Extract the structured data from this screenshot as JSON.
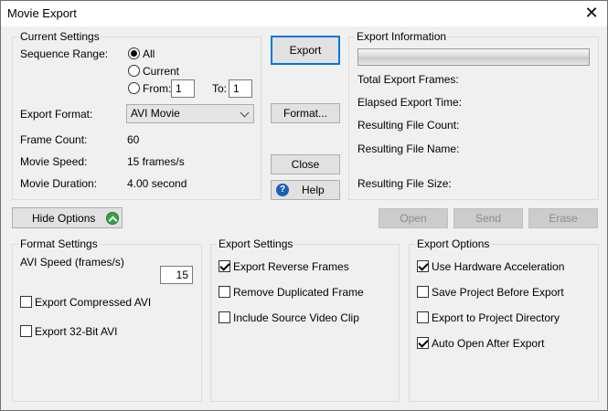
{
  "window": {
    "title": "Movie Export",
    "close_glyph": "✕"
  },
  "current_settings": {
    "title": "Current Settings",
    "sequence_range_label": "Sequence Range:",
    "radio_all": "All",
    "radio_current": "Current",
    "radio_from": "From:",
    "from_value": "1",
    "to_label": "To:",
    "to_value": "1",
    "selected_range": "All",
    "export_format_label": "Export Format:",
    "export_format_value": "AVI Movie",
    "frame_count_label": "Frame Count:",
    "frame_count_value": "60",
    "movie_speed_label": "Movie Speed:",
    "movie_speed_value": "15 frames/s",
    "movie_duration_label": "Movie Duration:",
    "movie_duration_value": "4.00 second"
  },
  "actions": {
    "export": "Export",
    "format": "Format...",
    "close": "Close",
    "help": "Help",
    "help_icon": "?"
  },
  "export_information": {
    "title": "Export Information",
    "progress": 0,
    "total_frames_label": "Total Export Frames:",
    "elapsed_time_label": "Elapsed Export Time:",
    "file_count_label": "Resulting File Count:",
    "file_name_label": "Resulting File Name:",
    "file_size_label": "Resulting File Size:"
  },
  "toolbar": {
    "hide_options": "Hide Options",
    "open": "Open",
    "send": "Send",
    "erase": "Erase"
  },
  "format_settings": {
    "title": "Format Settings",
    "avi_speed_label": "AVI Speed (frames/s)",
    "avi_speed_value": "15",
    "export_compressed": {
      "label": "Export Compressed AVI",
      "checked": false
    },
    "export_32bit": {
      "label": "Export 32-Bit AVI",
      "checked": false
    }
  },
  "export_settings": {
    "title": "Export Settings",
    "reverse_frames": {
      "label": "Export Reverse Frames",
      "checked": true
    },
    "remove_duplicated": {
      "label": "Remove Duplicated Frame",
      "checked": false
    },
    "include_source": {
      "label": "Include Source Video Clip",
      "checked": false
    }
  },
  "export_options": {
    "title": "Export Options",
    "hardware_accel": {
      "label": "Use Hardware Acceleration",
      "checked": true
    },
    "save_project": {
      "label": "Save Project Before Export",
      "checked": false
    },
    "export_to_dir": {
      "label": "Export to Project Directory",
      "checked": false
    },
    "auto_open": {
      "label": "Auto Open After Export",
      "checked": true
    }
  },
  "colors": {
    "accent": "#0078d7",
    "background": "#f0f0f0"
  }
}
